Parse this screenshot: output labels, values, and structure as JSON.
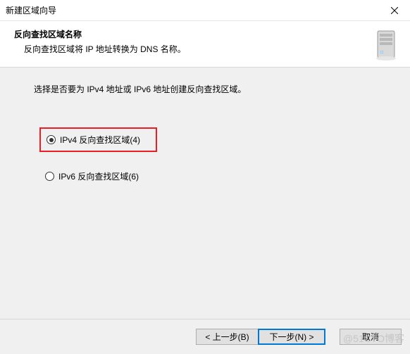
{
  "window": {
    "title": "新建区域向导"
  },
  "header": {
    "title": "反向查找区域名称",
    "subtitle": "反向查找区域将 IP 地址转换为 DNS 名称。"
  },
  "body": {
    "instruction": "选择是否要为 IPv4 地址或 IPv6 地址创建反向查找区域。",
    "options": {
      "ipv4": {
        "label": "IPv4 反向查找区域(4)",
        "selected": true
      },
      "ipv6": {
        "label": "IPv6 反向查找区域(6)",
        "selected": false
      }
    }
  },
  "footer": {
    "back": "< 上一步(B)",
    "next": "下一步(N) >",
    "cancel": "取消"
  },
  "watermark": "@51CTO博客"
}
